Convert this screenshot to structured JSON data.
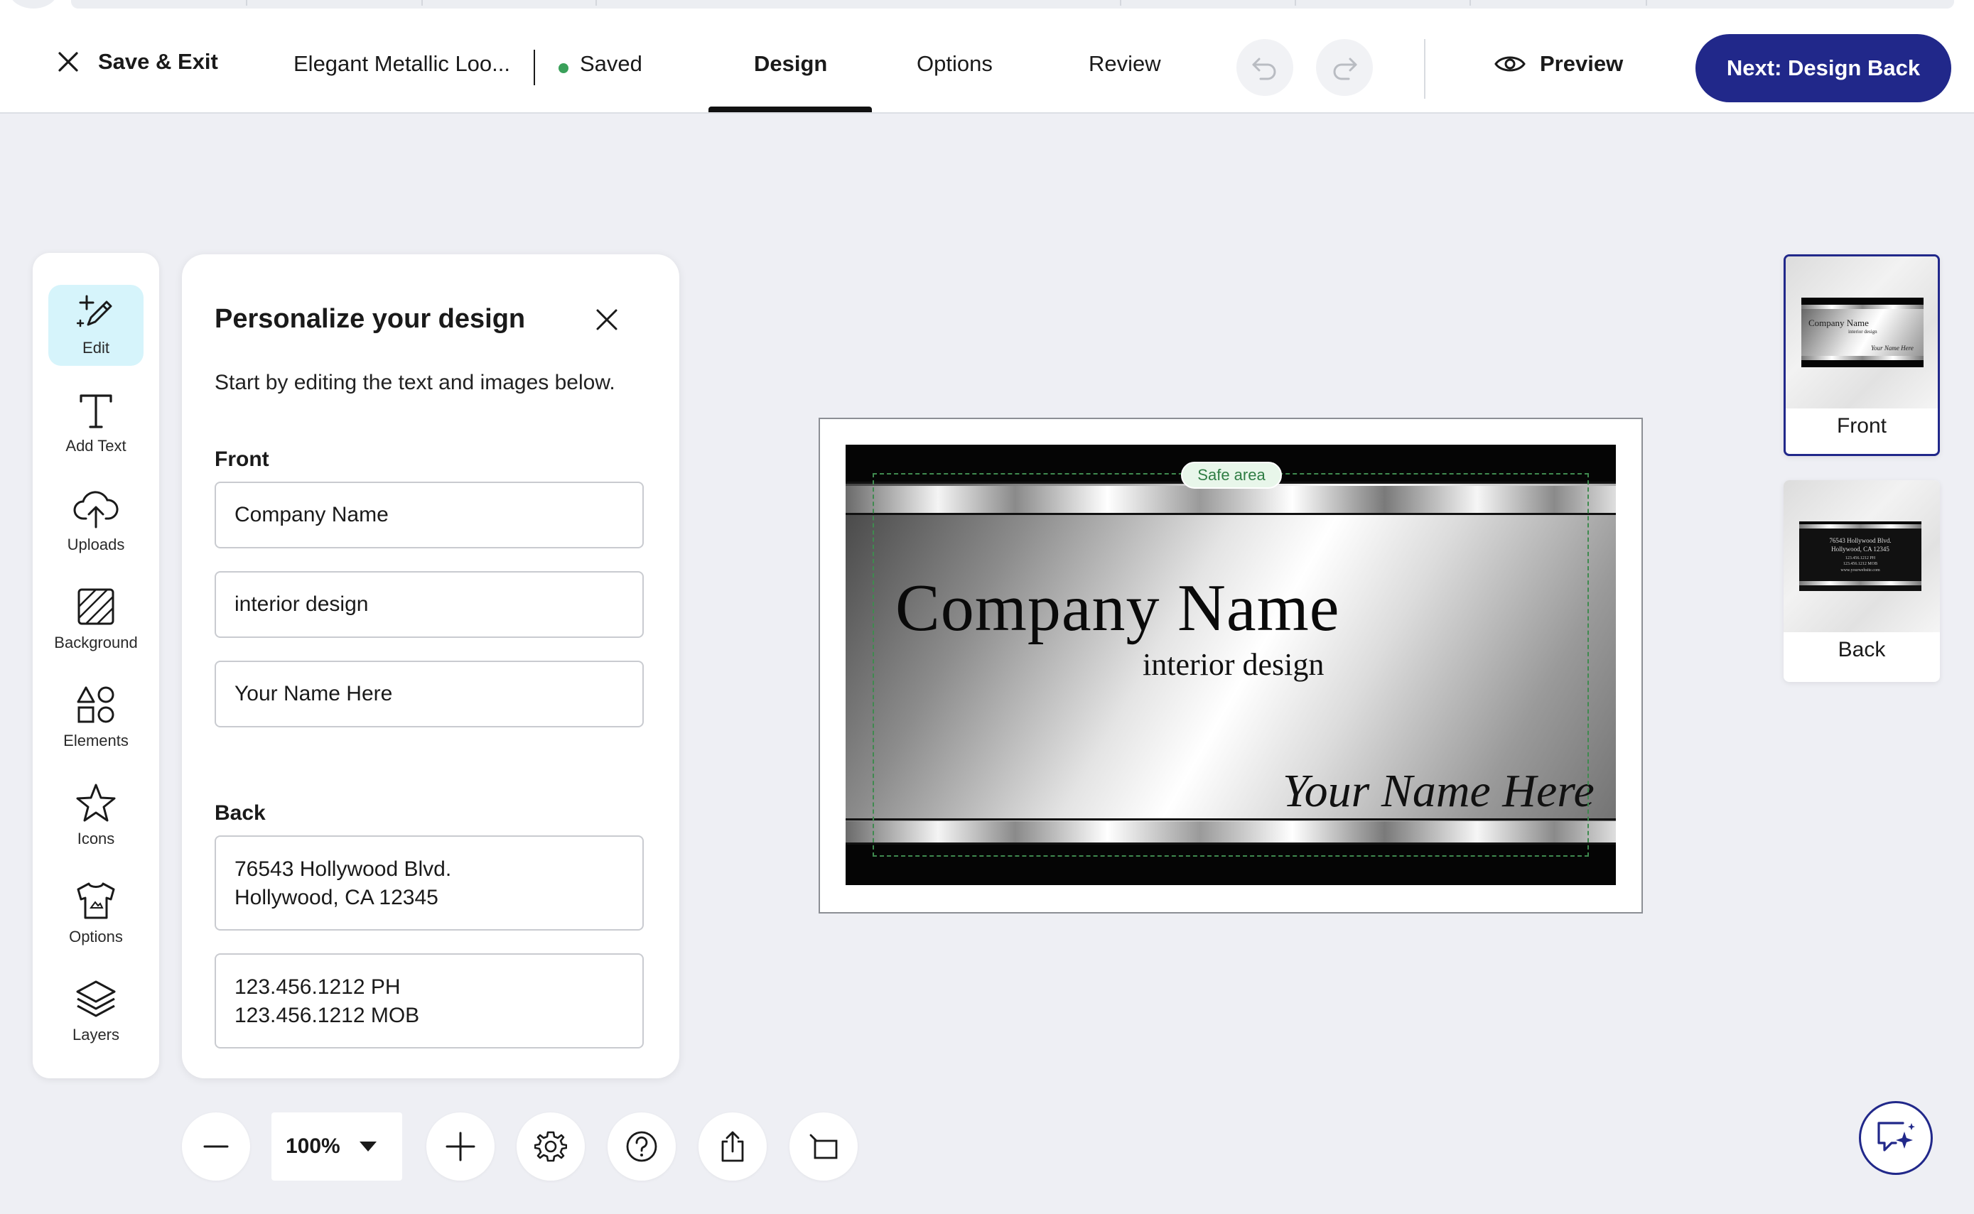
{
  "header": {
    "save_exit_label": "Save & Exit",
    "document_title": "Elegant Metallic Loo...",
    "save_status": "Saved",
    "tabs": [
      {
        "label": "Design",
        "active": true
      },
      {
        "label": "Options",
        "active": false
      },
      {
        "label": "Review",
        "active": false
      }
    ],
    "preview_label": "Preview",
    "next_label": "Next: Design Back"
  },
  "tools": [
    {
      "label": "Edit",
      "icon": "edit-sparkle-icon",
      "active": true
    },
    {
      "label": "Add Text",
      "icon": "text-icon",
      "active": false
    },
    {
      "label": "Uploads",
      "icon": "upload-cloud-icon",
      "active": false
    },
    {
      "label": "Background",
      "icon": "background-icon",
      "active": false
    },
    {
      "label": "Elements",
      "icon": "shapes-icon",
      "active": false
    },
    {
      "label": "Icons",
      "icon": "star-icon",
      "active": false
    },
    {
      "label": "Options",
      "icon": "shirt-icon",
      "active": false
    },
    {
      "label": "Layers",
      "icon": "layers-icon",
      "active": false
    }
  ],
  "panel": {
    "title": "Personalize your design",
    "subtitle": "Start by editing the text and images below.",
    "front_label": "Front",
    "front_fields": [
      "Company Name",
      "interior design",
      "Your Name Here"
    ],
    "back_label": "Back",
    "back_fields": [
      "76543 Hollywood Blvd.\nHollywood, CA 12345",
      "123.456.1212 PH\n123.456.1212 MOB"
    ]
  },
  "card": {
    "company": "Company Name",
    "tagline": "interior design",
    "name": "Your Name Here",
    "safe_area_label": "Safe area"
  },
  "pages": {
    "front": {
      "label": "Front",
      "lines": [
        "Company Name",
        "interior design",
        "Your Name Here"
      ]
    },
    "back": {
      "label": "Back",
      "lines": [
        "76543 Hollywood Blvd.",
        "Hollywood, CA 12345",
        "123.456.1212 PH",
        "123.456.1212 MOB",
        "www.yourwebsite.com"
      ]
    }
  },
  "toolbar": {
    "zoom_value": "100%"
  },
  "colors": {
    "brand": "#21288a",
    "active_tool_bg": "#d6f4fb",
    "saved_dot": "#3aa05a",
    "safe_area": "#3f8a4f"
  }
}
